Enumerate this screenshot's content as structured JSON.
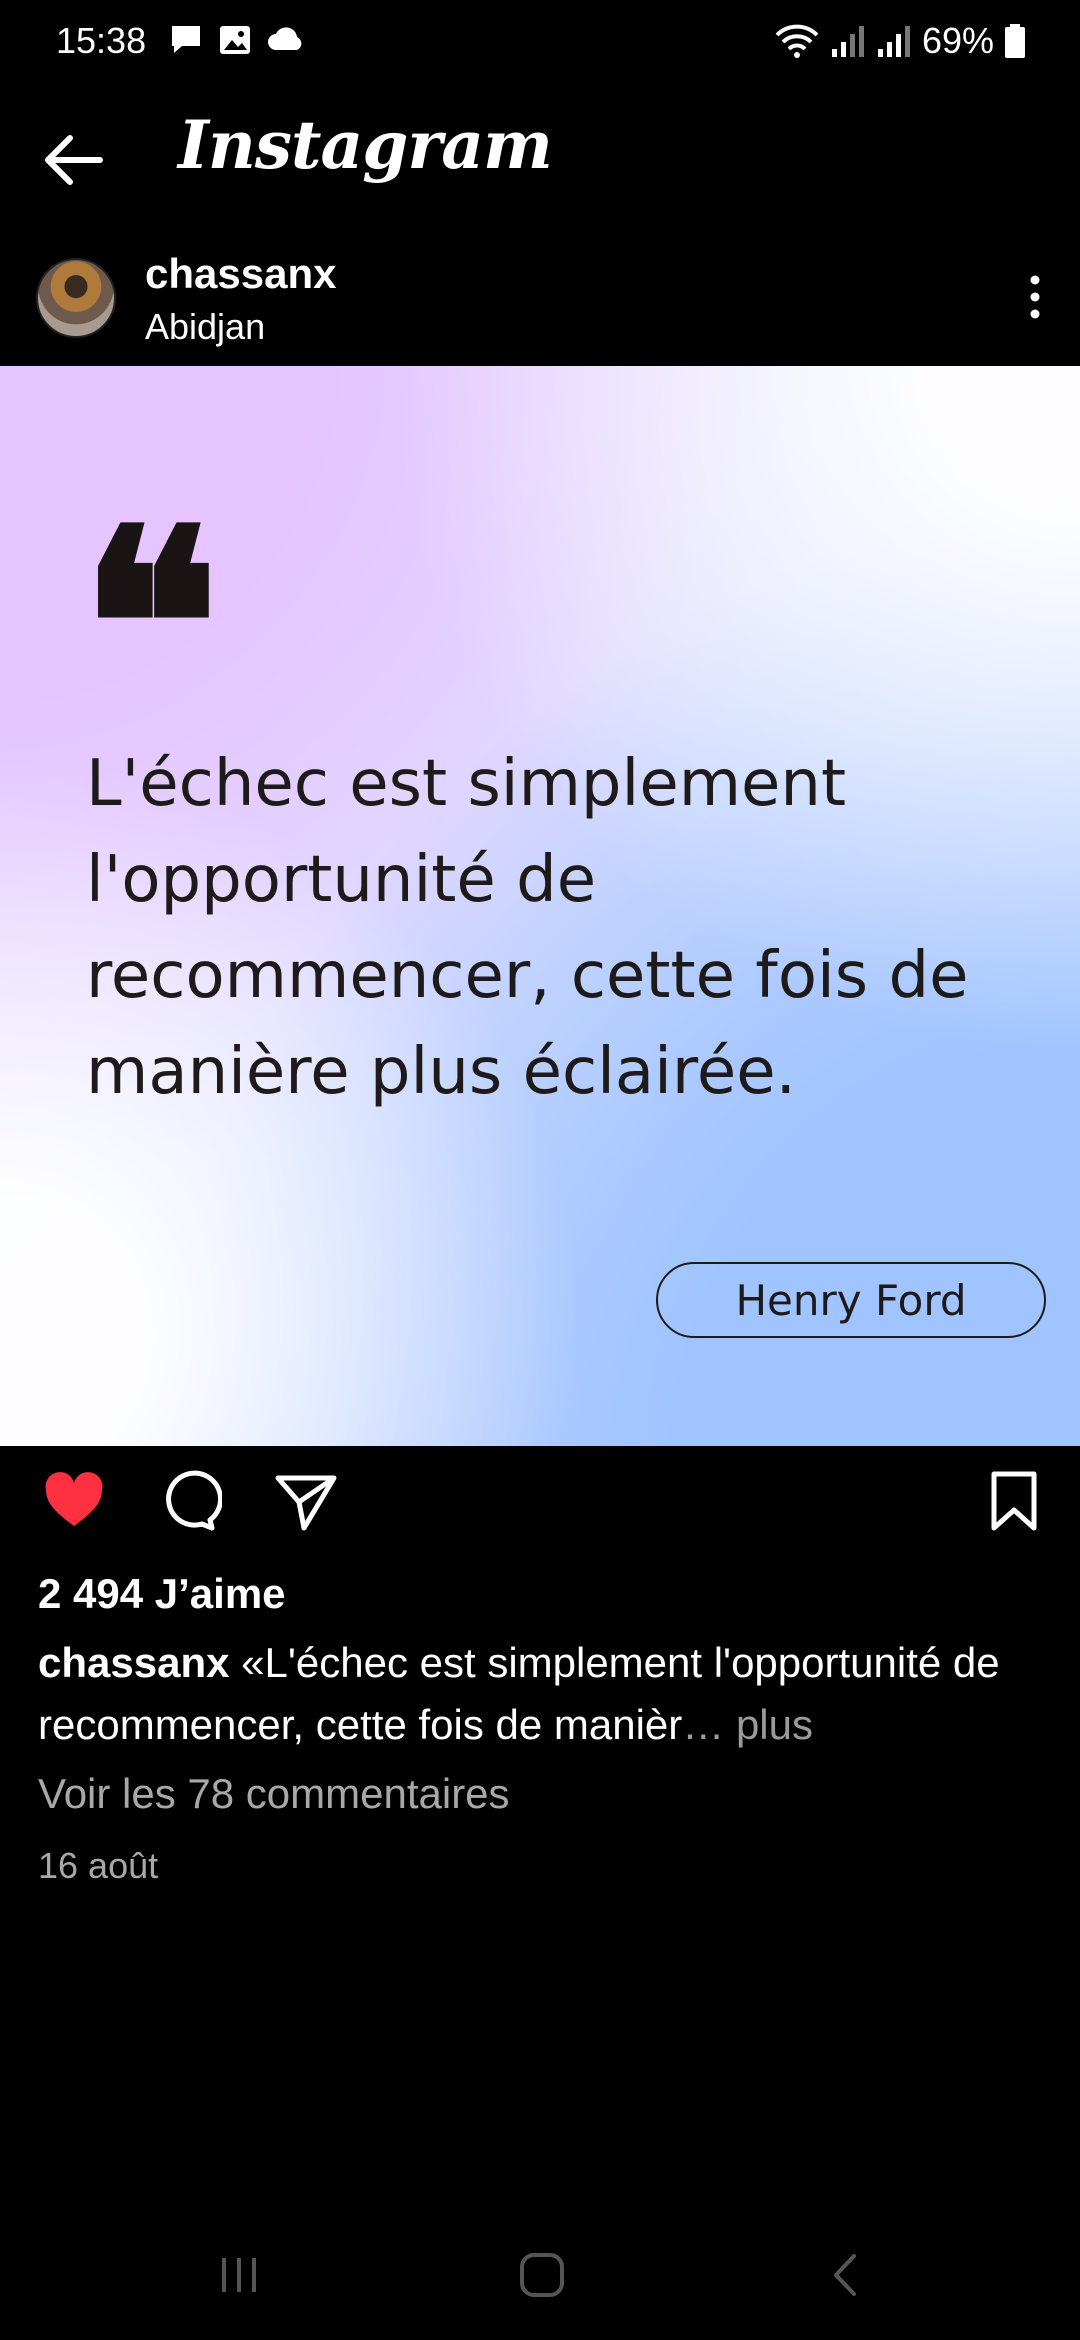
{
  "status_bar": {
    "time": "15:38",
    "battery": "69%",
    "icons": [
      "message-icon",
      "image-icon",
      "cloud-icon",
      "wifi-icon",
      "signal-icon",
      "signal-icon",
      "battery-icon"
    ]
  },
  "header": {
    "title": "Instagram",
    "back_icon": "back-arrow-icon"
  },
  "post": {
    "username": "chassanx",
    "location": "Abidjan",
    "quote_mark": "❝",
    "quote_text": "L'échec est simplement l'opportunité de recommencer, cette fois de manière plus éclairée.",
    "author": "Henry Ford",
    "likes": "2 494 J’aime",
    "caption_user": "chassanx",
    "caption_text": " «L'échec est simplement l'opportunité de recommencer, cette fois de manièr",
    "caption_more": "… plus",
    "view_comments": "Voir les 78 commentaires",
    "date": "16 août"
  },
  "colors": {
    "like": "#ff3040",
    "background": "#000000",
    "muted_text": "#a8a8a8"
  },
  "actions": [
    "heart-icon",
    "comment-icon",
    "share-icon",
    "bookmark-icon"
  ]
}
